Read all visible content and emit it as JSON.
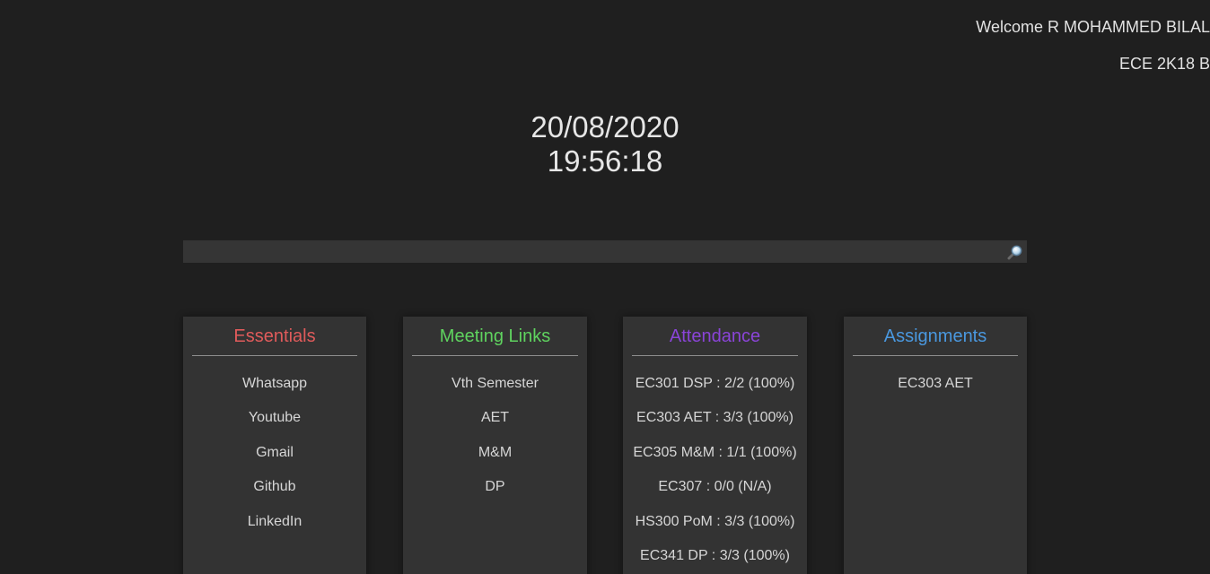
{
  "header": {
    "welcome": "Welcome R MOHAMMED BILAL",
    "batch": "ECE 2K18 B"
  },
  "clock": {
    "date": "20/08/2020",
    "time": "19:56:18"
  },
  "search": {
    "value": "",
    "icon": "magnifier-icon"
  },
  "colors": {
    "background": "#1f1f1f",
    "card": "#333333",
    "essentials": "#e05b5b",
    "meetings": "#5fd35f",
    "attendance": "#8a44d8",
    "assignments": "#4a98df"
  },
  "cards": {
    "essentials": {
      "title": "Essentials",
      "items": [
        "Whatsapp",
        "Youtube",
        "Gmail",
        "Github",
        "LinkedIn"
      ]
    },
    "meetings": {
      "title": "Meeting Links",
      "items": [
        "Vth Semester",
        "AET",
        "M&M",
        "DP"
      ]
    },
    "attendance": {
      "title": "Attendance",
      "items": [
        "EC301 DSP : 2/2 (100%)",
        "EC303 AET : 3/3 (100%)",
        "EC305 M&M : 1/1 (100%)",
        "EC307 : 0/0 (N/A)",
        "HS300 PoM : 3/3 (100%)",
        "EC341 DP : 3/3 (100%)"
      ]
    },
    "assignments": {
      "title": "Assignments",
      "items": [
        "EC303 AET"
      ]
    }
  }
}
